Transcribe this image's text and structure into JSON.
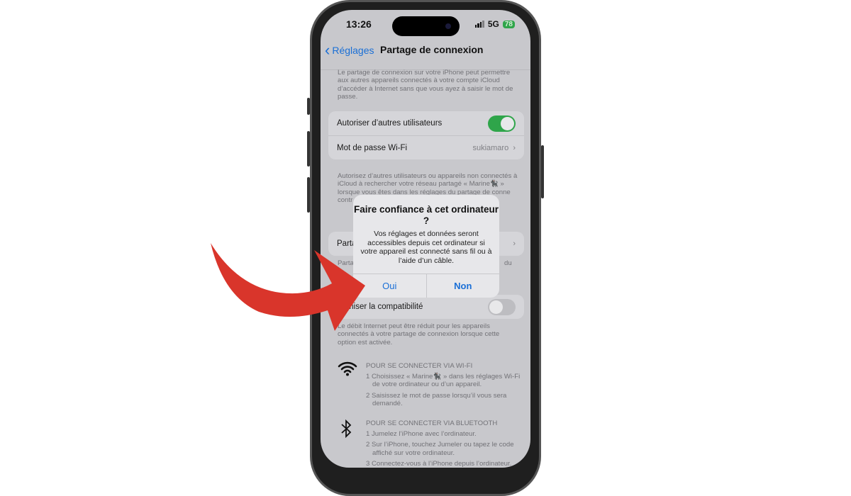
{
  "status_bar": {
    "time": "13:26",
    "network": "5G",
    "battery": "78"
  },
  "nav": {
    "back_label": "Réglages",
    "title": "Partage de connexion"
  },
  "intro_note": "Le partage de connexion sur votre iPhone peut permettre aux autres appareils connectés à votre compte iCloud d’accéder à Internet sans que vous ayez à saisir le mot de passe.",
  "settings": {
    "allow_others": {
      "label": "Autoriser d’autres utilisateurs",
      "enabled": true
    },
    "wifi_password": {
      "label": "Mot de passe Wi-Fi",
      "value": "sukiamaro"
    }
  },
  "allow_note": "Autorisez d’autres utilisateurs ou appareils non connectés à iCloud à rechercher votre réseau partagé « Marine🐈‍⬛ » lorsque vous êtes dans les réglages du partage de conne",
  "allow_note_tail": "contr",
  "family_row_label": "Parta",
  "family_note": "Parta",
  "family_note_tail": "du",
  "compat": {
    "label": "…imiser la compatibilité",
    "enabled": false
  },
  "compat_note": "Le débit Internet peut être réduit pour les appareils connectés à votre partage de connexion lorsque cette option est activée.",
  "wifi_section": {
    "icon": "wifi-icon",
    "heading": "POUR SE CONNECTER VIA WI-FI",
    "steps": [
      "1 Choisissez « Marine🐈‍⬛ » dans les réglages Wi-Fi de votre ordinateur ou d’un appareil.",
      "2 Saisissez le mot de passe lorsqu’il vous sera demandé."
    ]
  },
  "bt_section": {
    "icon": "bluetooth-icon",
    "heading": "POUR SE CONNECTER VIA BLUETOOTH",
    "steps": [
      "1 Jumelez l’iPhone avec l’ordinateur.",
      "2 Sur l’iPhone, touchez Jumeler ou tapez le code affiché sur votre ordinateur.",
      "3 Connectez-vous à l’iPhone depuis l’ordinateur."
    ]
  },
  "dialog": {
    "title": "Faire confiance à cet ordinateur ?",
    "message": "Vos réglages et données seront accessibles depuis cet ordinateur si votre appareil est connecté sans fil ou à l’aide d’un câble.",
    "yes": "Oui",
    "no": "Non"
  },
  "colors": {
    "accent": "#1a6fd6",
    "toggle_on": "#2fa54a",
    "arrow": "#d9352b"
  }
}
